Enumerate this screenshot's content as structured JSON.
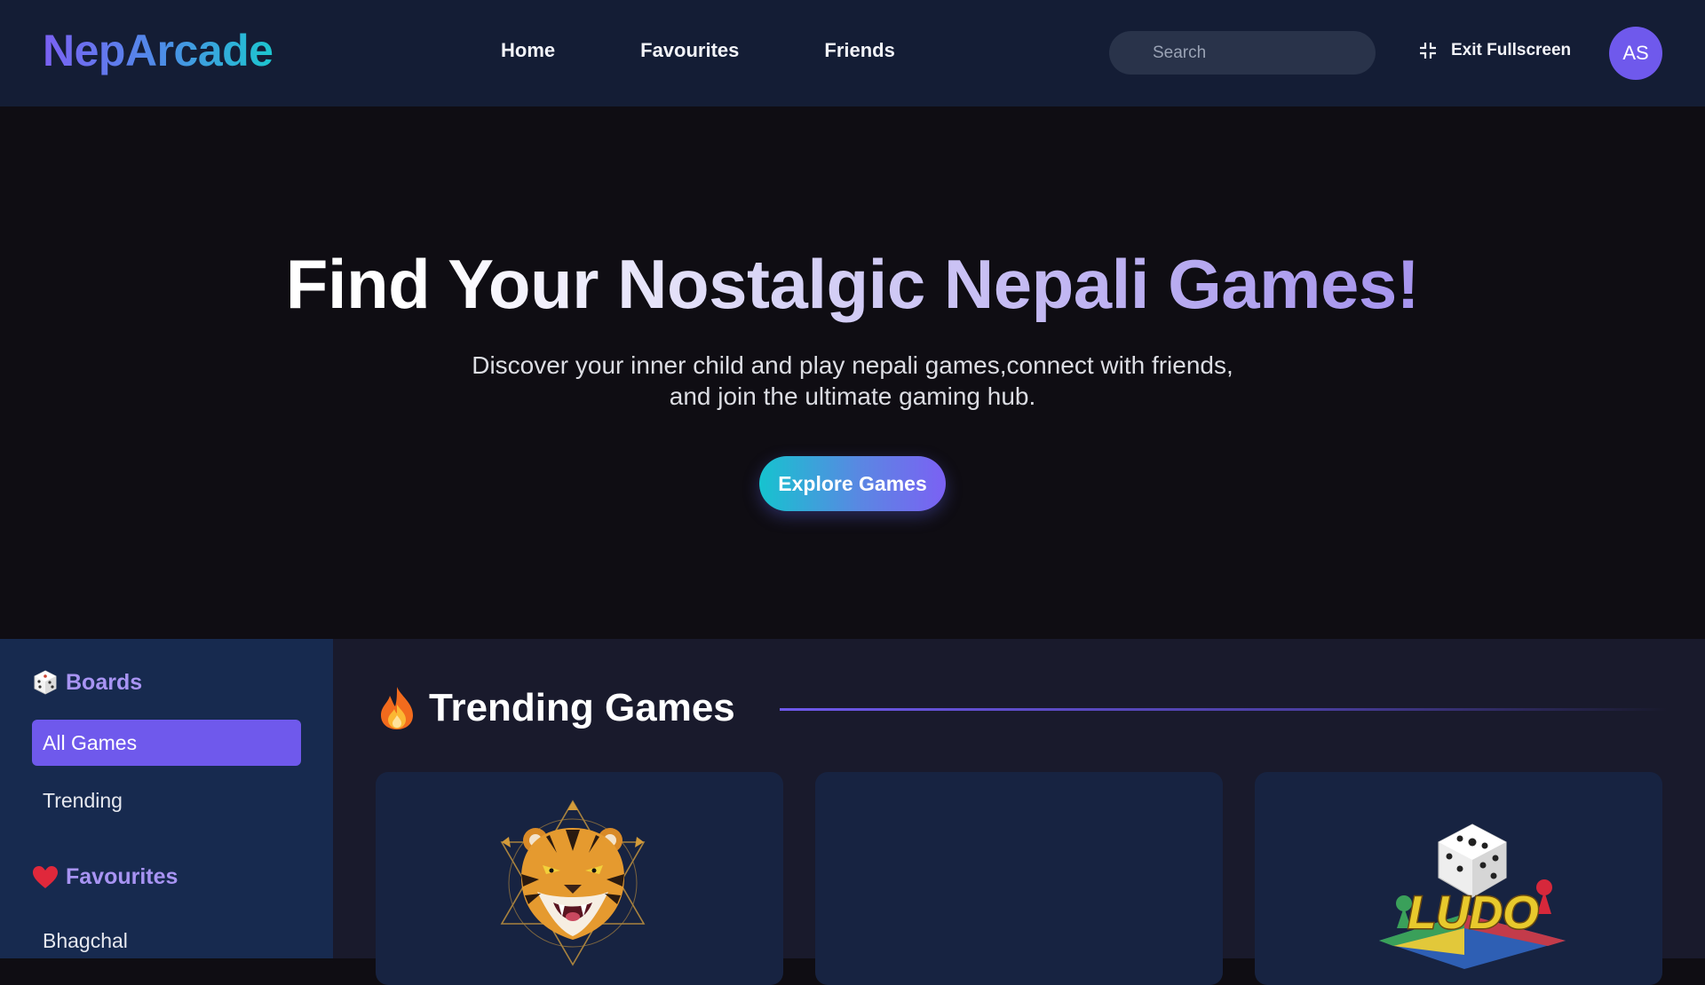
{
  "header": {
    "logo": "NepArcade",
    "nav": [
      "Home",
      "Favourites",
      "Friends"
    ],
    "search_placeholder": "Search",
    "exit_fullscreen": "Exit Fullscreen",
    "avatar_initials": "AS"
  },
  "hero": {
    "title": "Find Your Nostalgic Nepali Games!",
    "subtitle_line1": "Discover your inner child and play nepali games,connect with friends,",
    "subtitle_line2": "and join the ultimate gaming hub.",
    "cta": "Explore Games"
  },
  "sidebar": {
    "boards_heading": "Boards",
    "boards_icon": "die-icon",
    "boards_items": [
      {
        "label": "All Games",
        "active": true
      },
      {
        "label": "Trending",
        "active": false
      }
    ],
    "favourites_heading": "Favourites",
    "favourites_icon": "heart-icon",
    "favourites_items": [
      "Bhagchal"
    ]
  },
  "main": {
    "section_title": "Trending Games",
    "section_icon": "fire-icon",
    "cards": [
      {
        "thumbnail": "tiger-emblem"
      },
      {
        "thumbnail": "empty"
      },
      {
        "thumbnail": "ludo-logo",
        "logo_text": "LUDO"
      }
    ]
  },
  "colors": {
    "header_bg": "#141d35",
    "accent": "#6f59ec",
    "teal": "#1cc6cf",
    "sidebar_bg": "#172a4f",
    "main_bg": "#191a2c",
    "card_bg": "#172341"
  }
}
